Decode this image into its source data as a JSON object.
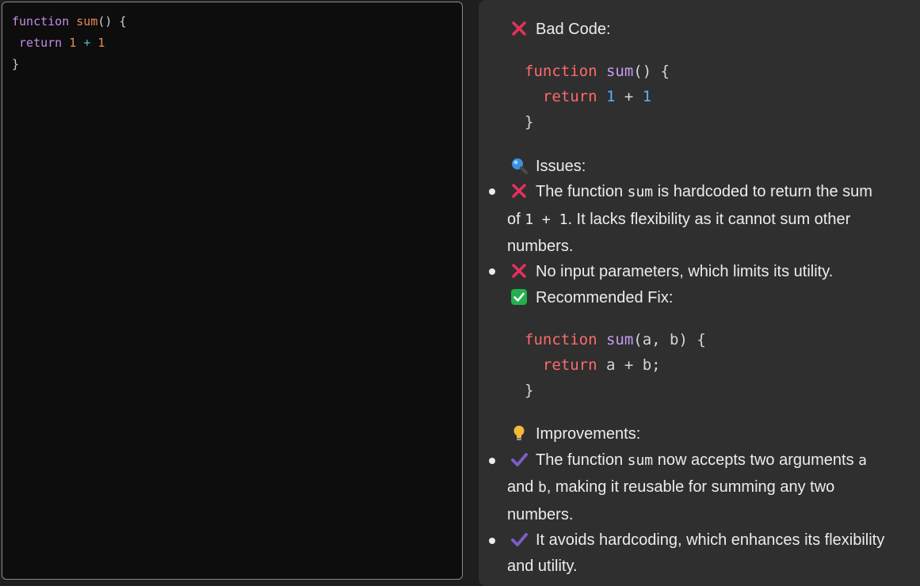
{
  "editor": {
    "line1": {
      "kw": "function",
      "name": "sum",
      "rest": "() {"
    },
    "line2": {
      "kw": "return",
      "n1": "1",
      "op": "+",
      "n2": "1"
    },
    "line3": "}"
  },
  "review": {
    "bad_code_heading": "Bad Code:",
    "bad_code": {
      "l1": {
        "kw": "function",
        "name": "sum",
        "rest": "() {"
      },
      "l2": {
        "kw": "return",
        "n1": "1",
        "op": "+",
        "n2": "1"
      },
      "l3": "}"
    },
    "issues_heading": "Issues:",
    "issues": [
      {
        "pre": "The function ",
        "code": "sum",
        "post": " is hardcoded to return the sum",
        "line2_pre": "of ",
        "line2_code": "1 + 1",
        "line2_post": ". It lacks flexibility as it cannot sum other",
        "line3": "numbers."
      },
      {
        "text": "No input parameters, which limits its utility."
      }
    ],
    "fix_heading": "Recommended Fix:",
    "fix_code": {
      "l1": {
        "kw": "function",
        "name": "sum",
        "rest": "(a, b) {"
      },
      "l2": {
        "kw": "return",
        "rest": "a + b;"
      },
      "l3": "}"
    },
    "improvements_heading": "Improvements:",
    "improvements": [
      {
        "pre": "The function ",
        "code": "sum",
        "post": " now accepts two arguments ",
        "code2": "a",
        "line2_pre": "and ",
        "line2_code": "b",
        "line2_post": ", making it reusable for summing any two",
        "line3": "numbers."
      },
      {
        "line1": "It avoids hardcoding, which enhances its flexibility",
        "line2": "and utility."
      }
    ]
  },
  "icons": {
    "bad": "cross-icon",
    "issues": "magnifier-icon",
    "fix": "check-box-icon",
    "improvements": "lightbulb-icon",
    "improvement_item": "checkmark-icon"
  },
  "colors": {
    "cross": "#e5315a",
    "check_box": "#22b14c",
    "checkmark": "#7c5cc4",
    "bulb": "#f5b93a"
  }
}
